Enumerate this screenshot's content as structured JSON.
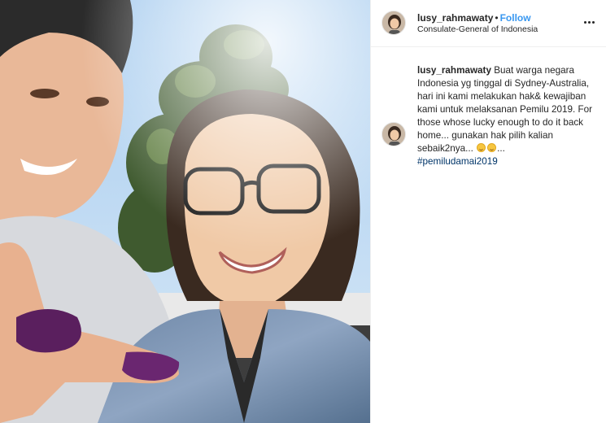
{
  "post": {
    "photo": {
      "description_icon": "selfie-photo"
    },
    "header": {
      "username": "lusy_rahmawaty",
      "separator": "•",
      "follow_label": "Follow",
      "location": "Consulate-General of Indonesia",
      "more_icon": "more-horizontal-icon"
    },
    "caption": {
      "username": "lusy_rahmawaty",
      "text": "Buat warga negara Indonesia yg tinggal di Sydney-Australia, hari ini kami melakukan hak& kewajiban kami untuk melaksanan Pemilu 2019. For those whose lucky enough to do it back home... gunakan hak pilih kalian sebaik2nya...",
      "ellipsis": "...",
      "hashtag": "#pemiludamai2019",
      "emoji_icons": [
        "smiling-face-icon",
        "hugging-face-icon"
      ]
    }
  },
  "colors": {
    "follow": "#3897f0",
    "hashtag": "#003569",
    "text": "#262626",
    "divider": "#efefef"
  }
}
